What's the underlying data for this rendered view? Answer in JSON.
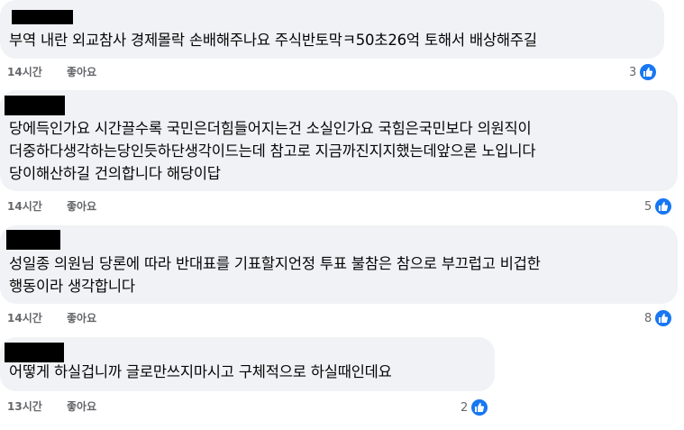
{
  "colors": {
    "bubble_bg": "#f0f2f5",
    "text": "#050505",
    "meta_text": "#65676b",
    "like_blue": "#1877f2"
  },
  "comments": [
    {
      "author_redacted": true,
      "text": "부역 내란 외교참사 경제몰락 손배해주나요 주식반토막ㅋ50초26억 토해서 배상해주길",
      "time": "14시간",
      "like_label": "좋아요",
      "reaction_count": "3",
      "reaction_icon": "thumbs-up-icon"
    },
    {
      "author_redacted": true,
      "text": "당에득인가요 시간끌수록 국민은더힘들어지는건 소실인가요 국힘은국민보다 의원직이\n더중하다생각하는당인듯하단생각이드는데 참고로 지금까진지지했는데앞으론 노입니다\n당이해산하길 건의합니다 해당이답",
      "time": "14시간",
      "like_label": "좋아요",
      "reaction_count": "5",
      "reaction_icon": "thumbs-up-icon"
    },
    {
      "author_redacted": true,
      "text": "성일종 의원님 당론에 따라 반대표를 기표할지언정 투표 불참은 참으로 부끄럽고 비겁한\n행동이라 생각합니다",
      "time": "14시간",
      "like_label": "좋아요",
      "reaction_count": "8",
      "reaction_icon": "thumbs-up-icon"
    },
    {
      "author_redacted": true,
      "text": "어떻게 하실겁니까 글로만쓰지마시고 구체적으로 하실때인데요",
      "time": "13시간",
      "like_label": "좋아요",
      "reaction_count": "2",
      "reaction_icon": "thumbs-up-icon"
    }
  ]
}
